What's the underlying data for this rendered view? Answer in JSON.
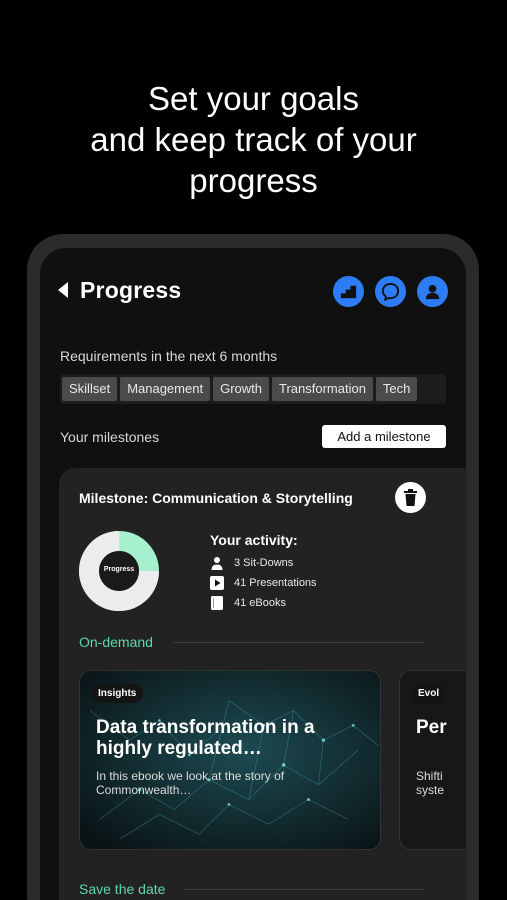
{
  "headline": {
    "line1": "Set your goals",
    "line2": "and keep track of your",
    "line3": "progress"
  },
  "header": {
    "title": "Progress",
    "icons": [
      "chart-steps-icon",
      "chat-bubble-icon",
      "profile-icon"
    ],
    "accent_color": "#2d7cf6"
  },
  "requirements": {
    "label": "Requirements in the next 6 months",
    "tags": [
      "Skillset",
      "Management",
      "Growth",
      "Transformation",
      "Tech"
    ]
  },
  "milestones": {
    "label": "Your milestones",
    "add_button": "Add a milestone"
  },
  "milestone_card": {
    "title": "Milestone: Communication & Storytelling",
    "progress_label": "Progress",
    "progress_fraction": 0.25,
    "progress_color": "#a6f0cf",
    "activity_title": "Your activity:",
    "activity": [
      {
        "icon": "person-icon",
        "text": "3 Sit-Downs"
      },
      {
        "icon": "play-icon",
        "text": "41 Presentations"
      },
      {
        "icon": "book-icon",
        "text": "41 eBooks"
      }
    ]
  },
  "on_demand": {
    "heading": "On-demand",
    "heading_color": "#5ed8a8",
    "tiles": [
      {
        "badge": "Insights",
        "title": "Data transformation in a highly regulated…",
        "subtitle": "In this ebook we look at the story of Commonwealth…"
      },
      {
        "badge": "Evol",
        "title": "Per",
        "subtitle": "Shifti syste"
      }
    ]
  },
  "save_the_date": {
    "heading": "Save the date"
  }
}
